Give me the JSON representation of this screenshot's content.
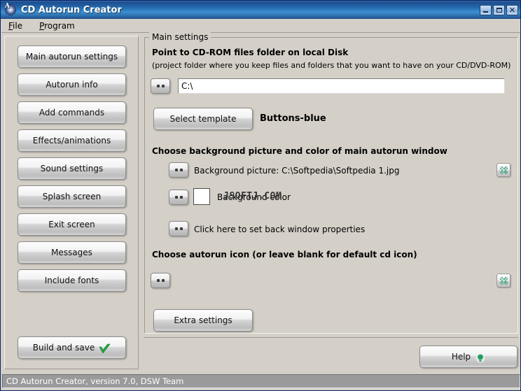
{
  "window": {
    "title": "CD Autorun Creator",
    "icon": "cd-disc-icon",
    "minimize_label": "Minimize",
    "maximize_label": "Maximize",
    "close_label": "Close"
  },
  "menubar": {
    "items": [
      {
        "label": "File",
        "accel": "F",
        "rest": "ile"
      },
      {
        "label": "Program",
        "accel": "P",
        "rest": "rogram"
      }
    ]
  },
  "sidebar": {
    "items": [
      {
        "label": "Main autorun settings"
      },
      {
        "label": "Autorun info"
      },
      {
        "label": "Add commands"
      },
      {
        "label": "Effects/animations"
      },
      {
        "label": "Sound settings"
      },
      {
        "label": "Splash screen"
      },
      {
        "label": "Exit screen"
      },
      {
        "label": "Messages"
      },
      {
        "label": "Include fonts"
      }
    ],
    "build_button": {
      "label": "Build and save",
      "icon": "green-check-icon"
    }
  },
  "main": {
    "group_title": "Main settings",
    "folder_section": {
      "heading": "Point to CD-ROM files folder on local Disk",
      "subtext": "(project folder where you keep files and folders that you want to have on your CD/DVD-ROM)",
      "browse_label": "...",
      "path_value": "C:\\",
      "path_placeholder": ""
    },
    "template_section": {
      "button_label": "Select template",
      "template_name": "Buttons-blue"
    },
    "background_section": {
      "heading": "Choose background picture and color of main autorun window",
      "picture_row": {
        "browse_label": "...",
        "label": "Background picture: C:\\Softpedia\\Softpedia 1.jpg",
        "clear_label": "x"
      },
      "color_row": {
        "browse_label": "...",
        "label": "Background color",
        "swatch_color": "#ffffff",
        "watermark": "JSOFTJ.COM"
      },
      "properties_row": {
        "browse_label": "...",
        "label": "Click here to set back window properties"
      }
    },
    "icon_section": {
      "heading": "Choose autorun icon (or leave blank for default cd icon)",
      "browse_label": "...",
      "clear_label": "x"
    },
    "extra_button": {
      "label": "Extra settings"
    }
  },
  "footer": {
    "help_button": {
      "label": "Help",
      "icon": "green-lightbulb-icon"
    },
    "status_text": "CD Autorun Creator, version 7.0, DSW Team"
  },
  "colors": {
    "titlebar_accent": "#2b6ba8",
    "window_face": "#d4d0c8",
    "statusbar": "#9a9a9a",
    "clear_icon_green": "#3f9e7a",
    "check_green": "#21a341"
  }
}
